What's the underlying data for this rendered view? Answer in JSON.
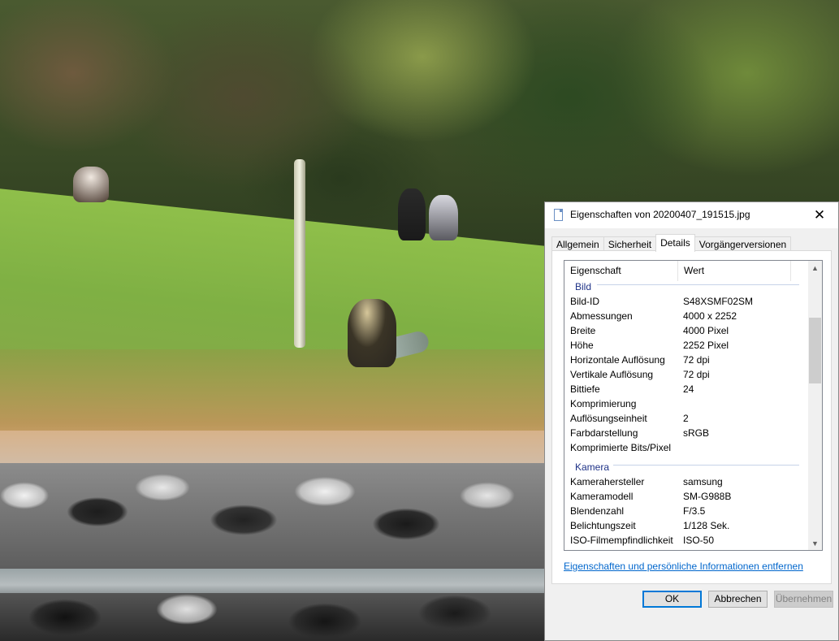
{
  "dialog": {
    "title": "Eigenschaften von 20200407_191515.jpg",
    "close_glyph": "✕",
    "tabs": [
      {
        "label": "Allgemein",
        "active": false
      },
      {
        "label": "Sicherheit",
        "active": false
      },
      {
        "label": "Details",
        "active": true
      },
      {
        "label": "Vorgängerversionen",
        "active": false
      }
    ],
    "columns": {
      "property": "Eigenschaft",
      "value": "Wert"
    },
    "groups": [
      {
        "name": "Bild",
        "rows": [
          {
            "key": "Bild-ID",
            "value": "S48XSMF02SM"
          },
          {
            "key": "Abmessungen",
            "value": "4000 x 2252"
          },
          {
            "key": "Breite",
            "value": "4000 Pixel"
          },
          {
            "key": "Höhe",
            "value": "2252 Pixel"
          },
          {
            "key": "Horizontale Auflösung",
            "value": "72 dpi"
          },
          {
            "key": "Vertikale Auflösung",
            "value": "72 dpi"
          },
          {
            "key": "Bittiefe",
            "value": "24"
          },
          {
            "key": "Komprimierung",
            "value": ""
          },
          {
            "key": "Auflösungseinheit",
            "value": "2"
          },
          {
            "key": "Farbdarstellung",
            "value": "sRGB"
          },
          {
            "key": "Komprimierte Bits/Pixel",
            "value": ""
          }
        ]
      },
      {
        "name": "Kamera",
        "rows": [
          {
            "key": "Kamerahersteller",
            "value": "samsung"
          },
          {
            "key": "Kameramodell",
            "value": "SM-G988B"
          },
          {
            "key": "Blendenzahl",
            "value": "F/3.5"
          },
          {
            "key": "Belichtungszeit",
            "value": "1/128 Sek."
          },
          {
            "key": "ISO-Filmempfindlichkeit",
            "value": "ISO-50"
          }
        ]
      }
    ],
    "scroll_position": 0.22,
    "scroll_visible_fraction": 0.25,
    "remove_link": "Eigenschaften und persönliche Informationen entfernen",
    "buttons": {
      "ok": "OK",
      "cancel": "Abbrechen",
      "apply": "Übernehmen"
    },
    "scroll_up_glyph": "▲",
    "scroll_down_glyph": "▼"
  },
  "colors": {
    "group_header": "#1e3287",
    "link": "#0066cc",
    "ok_border": "#0078d7"
  }
}
